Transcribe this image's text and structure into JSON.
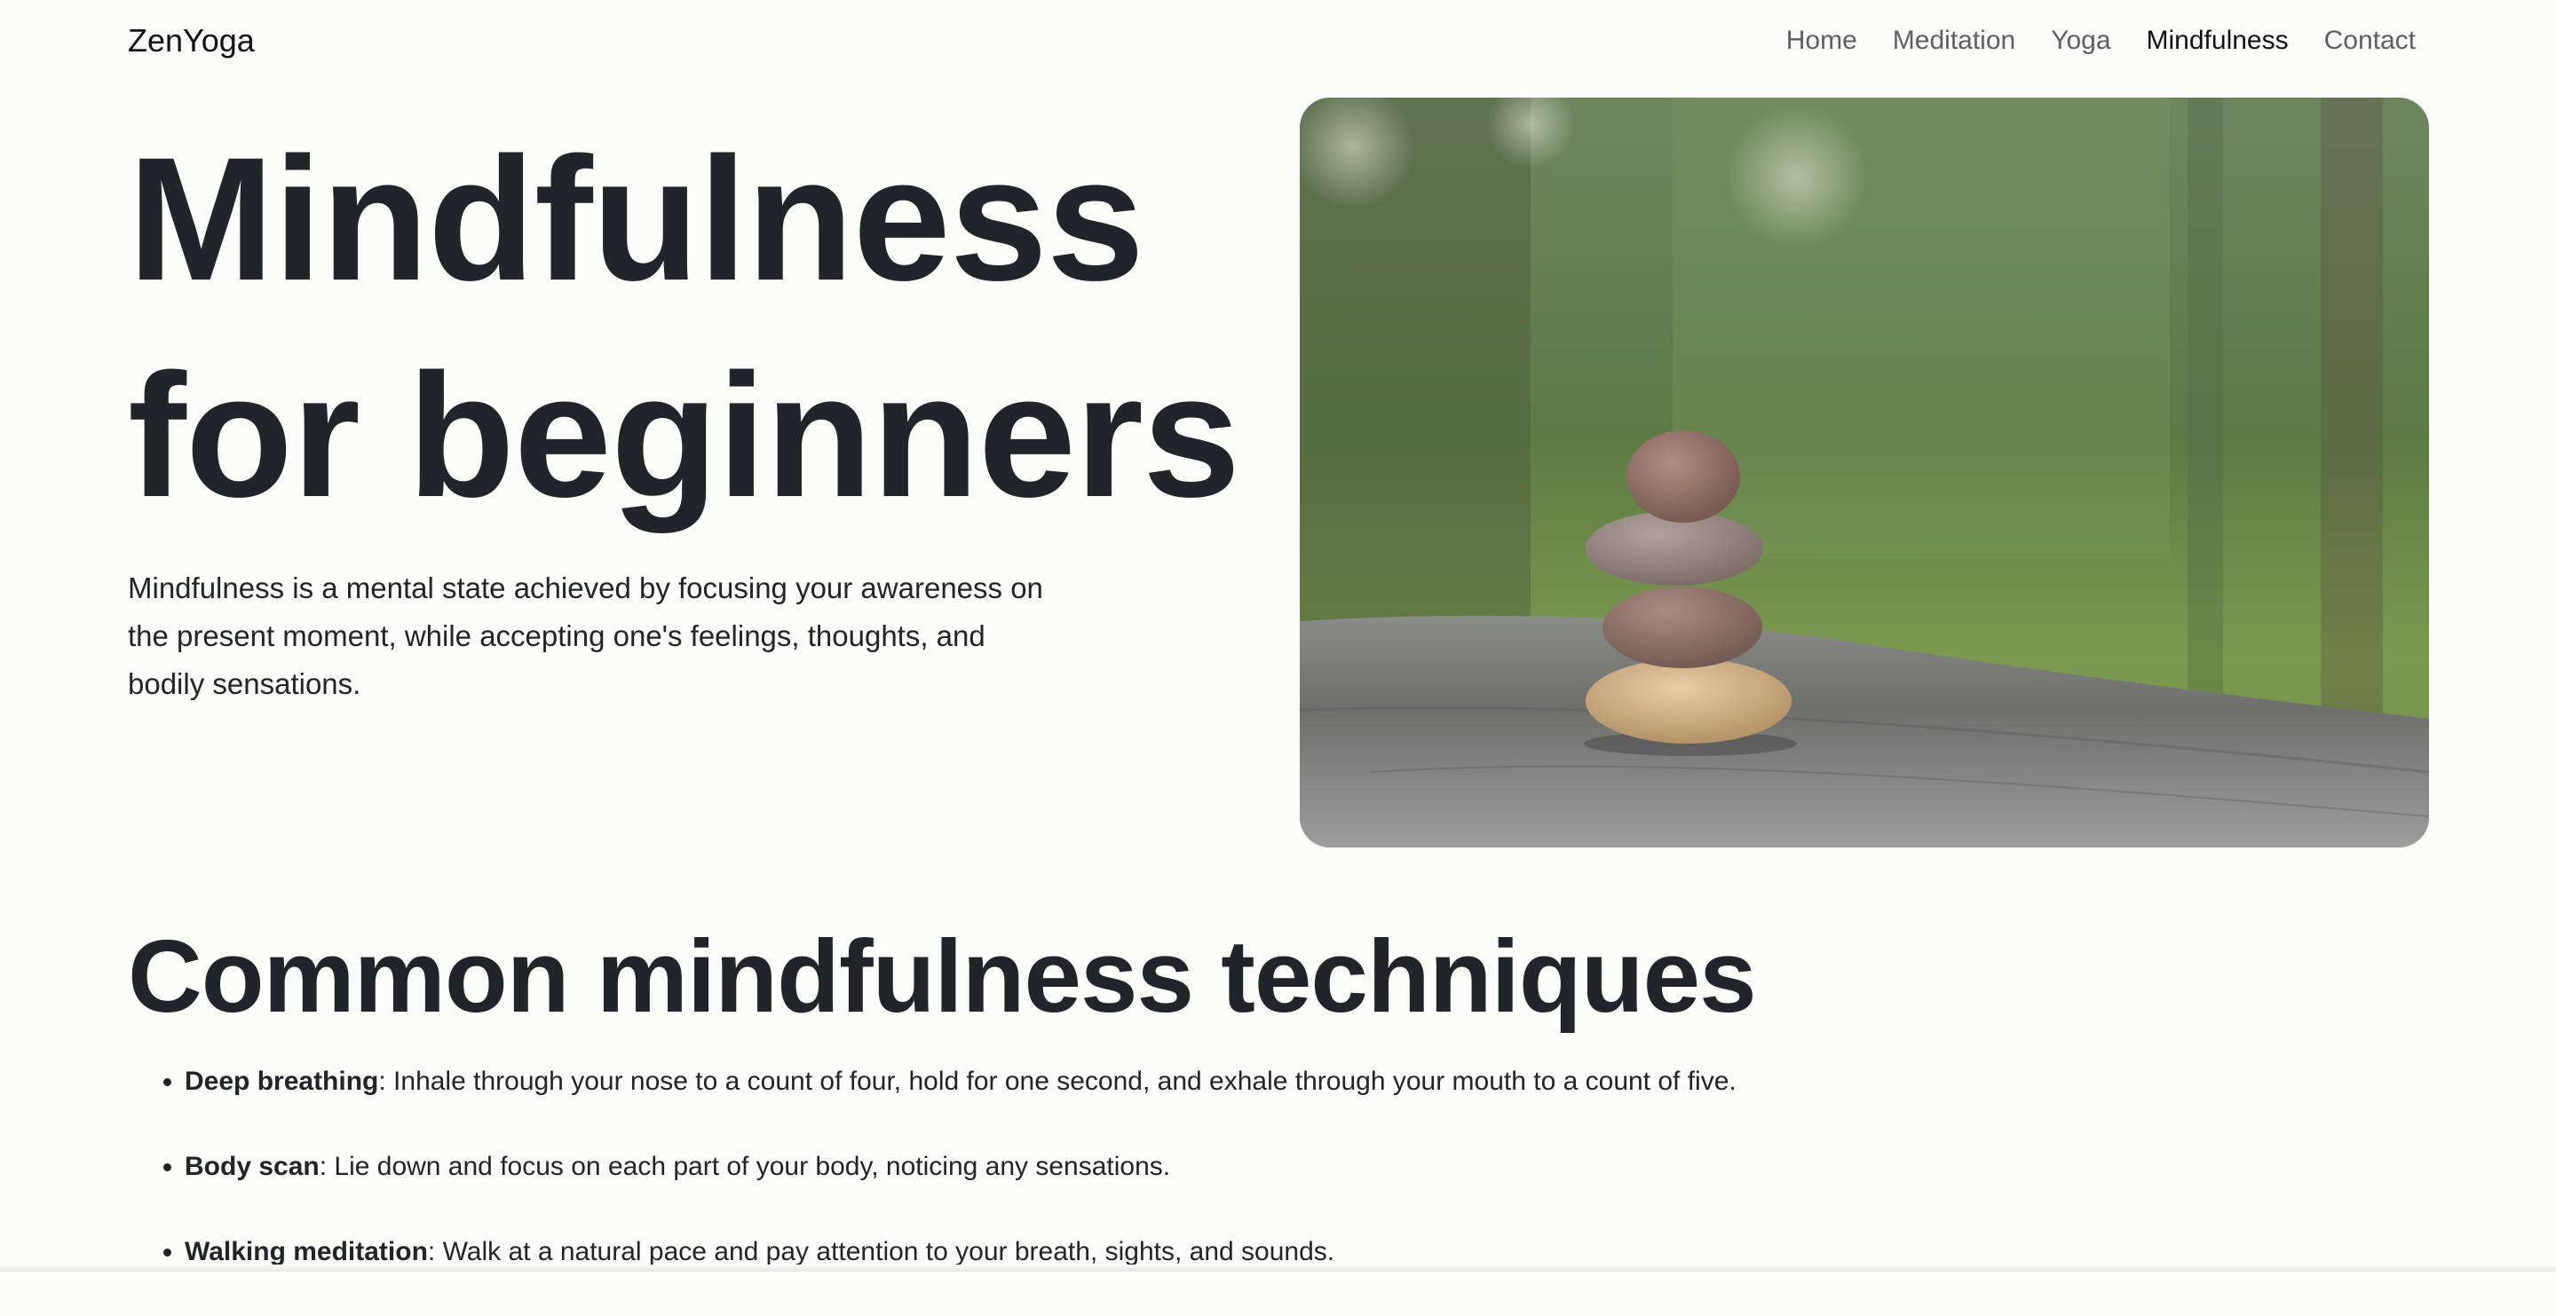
{
  "nav": {
    "brand": "ZenYoga",
    "links": [
      {
        "label": "Home",
        "active": false
      },
      {
        "label": "Meditation",
        "active": false
      },
      {
        "label": "Yoga",
        "active": false
      },
      {
        "label": "Mindfulness",
        "active": true
      },
      {
        "label": "Contact",
        "active": false
      }
    ]
  },
  "hero": {
    "title_line1": "Mindfulness",
    "title_line2": "for beginners",
    "lead": "Mindfulness is a mental state achieved by focusing your awareness on the present moment, while accepting one's feelings, thoughts, and bodily sensations.",
    "image_subject": "stacked-stones-photo"
  },
  "techniques": {
    "title": "Common mindfulness techniques",
    "items": [
      {
        "name": "Deep breathing",
        "text": ": Inhale through your nose to a count of four, hold for one second, and exhale through your mouth to a count of five."
      },
      {
        "name": "Body scan",
        "text": ": Lie down and focus on each part of your body, noticing any sensations."
      },
      {
        "name": "Walking meditation",
        "text": ": Walk at a natural pace and pay attention to your breath, sights, and sounds."
      }
    ]
  },
  "colors": {
    "background": "#fcfcfb",
    "text": "#212529",
    "nav_muted": "#5d5f62"
  }
}
